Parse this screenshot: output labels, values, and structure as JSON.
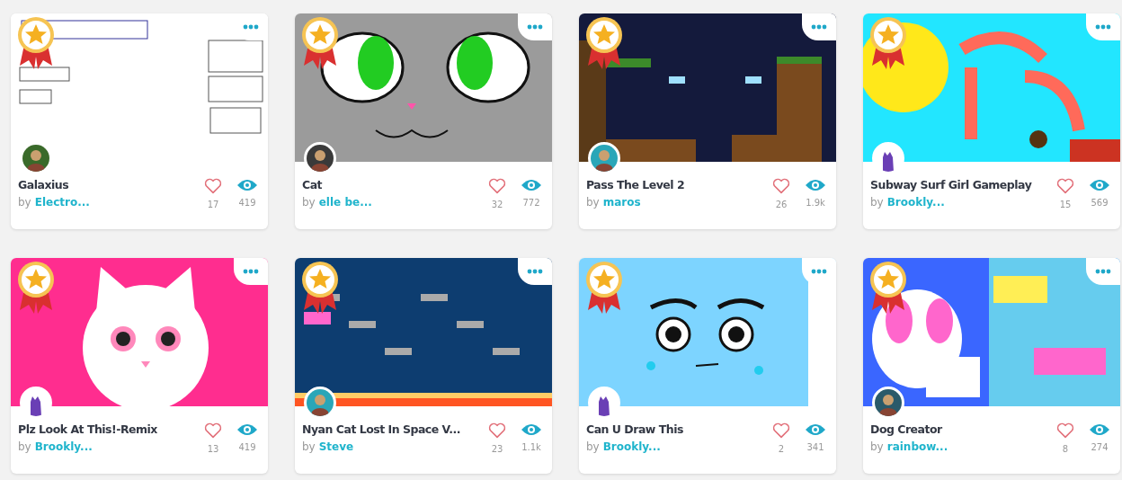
{
  "projects": [
    {
      "title": "Galaxius",
      "by": "by",
      "author": "Electro...",
      "likes": "17",
      "views": "419",
      "featured": true
    },
    {
      "title": "Cat",
      "by": "by",
      "author": "elle be...",
      "likes": "32",
      "views": "772",
      "featured": true
    },
    {
      "title": "Pass The Level 2",
      "by": "by",
      "author": "maros",
      "likes": "26",
      "views": "1.9k",
      "featured": true
    },
    {
      "title": "Subway Surf Girl Gameplay",
      "by": "by",
      "author": "Brookly...",
      "likes": "15",
      "views": "569",
      "featured": true
    },
    {
      "title": "Plz Look At This!-Remix",
      "by": "by",
      "author": "Brookly...",
      "likes": "13",
      "views": "419",
      "featured": true
    },
    {
      "title": "Nyan Cat Lost In Space V...",
      "by": "by",
      "author": "Steve",
      "likes": "23",
      "views": "1.1k",
      "featured": true
    },
    {
      "title": "Can U Draw This",
      "by": "by",
      "author": "Brookly...",
      "likes": "2",
      "views": "341",
      "featured": true
    },
    {
      "title": "Dog Creator",
      "by": "by",
      "author": "rainbow...",
      "likes": "8",
      "views": "274",
      "featured": true
    }
  ]
}
